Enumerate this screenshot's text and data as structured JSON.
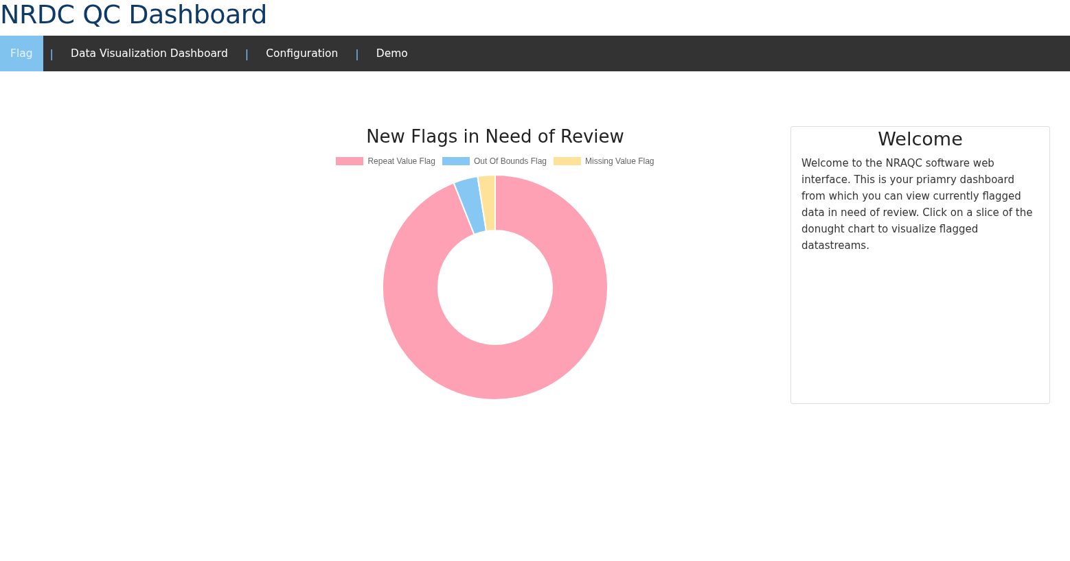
{
  "header": {
    "title": "NRDC QC Dashboard"
  },
  "nav": {
    "items": [
      {
        "label": "Flag",
        "selected": true
      },
      {
        "label": "Data Visualization Dashboard",
        "selected": false
      },
      {
        "label": "Configuration",
        "selected": false
      },
      {
        "label": "Demo",
        "selected": false
      }
    ],
    "separators": [
      "|",
      "|",
      "|"
    ]
  },
  "chart": {
    "title": "New Flags in Need of Review",
    "legend": [
      {
        "label": "Repeat Value Flag",
        "color": "#ffa1b5"
      },
      {
        "label": "Out Of Bounds Flag",
        "color": "#86c7f3"
      },
      {
        "label": "Missing Value Flag",
        "color": "#ffe29a"
      }
    ]
  },
  "welcome": {
    "title": "Welcome",
    "text": "Welcome to the NRAQC software web interface. This is your priamry dashboard from which you can view currently flagged data in need of review. Click on a slice of the donught chart to visualize flagged datastreams."
  }
}
